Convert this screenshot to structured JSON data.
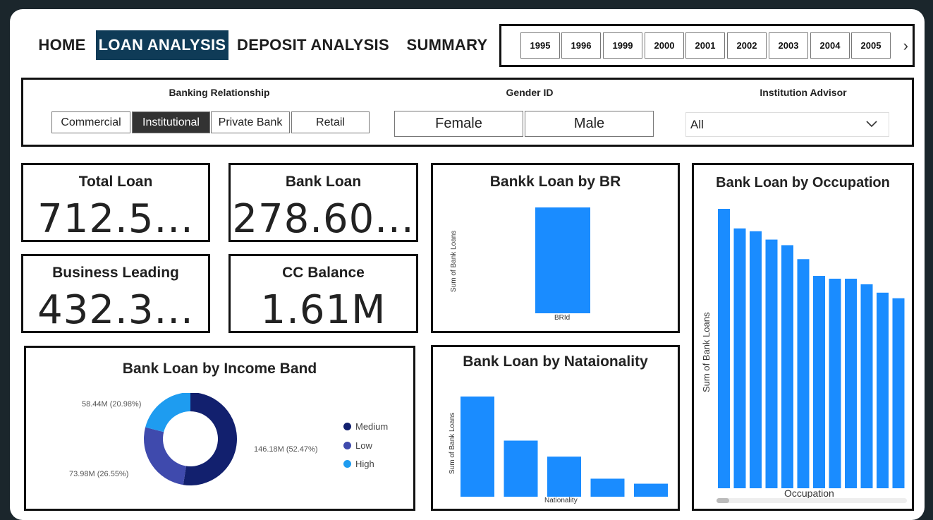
{
  "nav": {
    "home": "HOME",
    "loan_analysis": "LOAN ANALYSIS",
    "deposit_analysis": "DEPOSIT ANALYSIS",
    "summary": "SUMMARY"
  },
  "years": [
    "1995",
    "1996",
    "1999",
    "2000",
    "2001",
    "2002",
    "2003",
    "2004",
    "2005"
  ],
  "filters": {
    "banking_relationship": {
      "title": "Banking Relationship",
      "options": [
        "Commercial",
        "Institutional",
        "Private Bank",
        "Retail"
      ],
      "selected": "Institutional"
    },
    "gender": {
      "title": "Gender ID",
      "options": [
        "Female",
        "Male"
      ]
    },
    "advisor": {
      "title": "Institution Advisor",
      "value": "All"
    }
  },
  "kpis": {
    "total_loan": {
      "label": "Total Loan",
      "value": "712.5..."
    },
    "bank_loan": {
      "label": "Bank Loan",
      "value": "278.60..."
    },
    "business_leading": {
      "label": "Business Leading",
      "value": "432.3..."
    },
    "cc_balance": {
      "label": "CC Balance",
      "value": "1.61M"
    }
  },
  "colors": {
    "bar": "#1a8cff",
    "medium": "#12206e",
    "low": "#3f4aad",
    "high": "#1e9cf0",
    "nav_active": "#0f3b57"
  },
  "chart_data": [
    {
      "type": "bar",
      "id": "by_br",
      "title": "Bankk Loan by BR",
      "xlabel": "BRId",
      "ylabel": "Sum of Bank Loans",
      "values": [
        1
      ]
    },
    {
      "type": "bar",
      "id": "by_nationality",
      "title": "Bank Loan by Nataionality",
      "xlabel": "Nationality",
      "ylabel": "Sum of Bank Loans",
      "values": [
        100,
        56,
        40,
        18,
        13
      ]
    },
    {
      "type": "bar",
      "id": "by_occupation",
      "title": "Bank Loan by Occupation",
      "xlabel": "Occupation",
      "ylabel": "Sum of Bank Loans",
      "values": [
        100,
        93,
        92,
        89,
        87,
        82,
        76,
        75,
        75,
        73,
        70,
        68
      ]
    },
    {
      "type": "pie",
      "id": "by_income_band",
      "title": "Bank Loan by Income Band",
      "series": [
        {
          "name": "Medium",
          "value": 146.18,
          "label": "146.18M (52.47%)"
        },
        {
          "name": "Low",
          "value": 73.98,
          "label": "73.98M (26.55%)"
        },
        {
          "name": "High",
          "value": 58.44,
          "label": "58.44M (20.98%)"
        }
      ],
      "legend": [
        "Medium",
        "Low",
        "High"
      ]
    }
  ]
}
